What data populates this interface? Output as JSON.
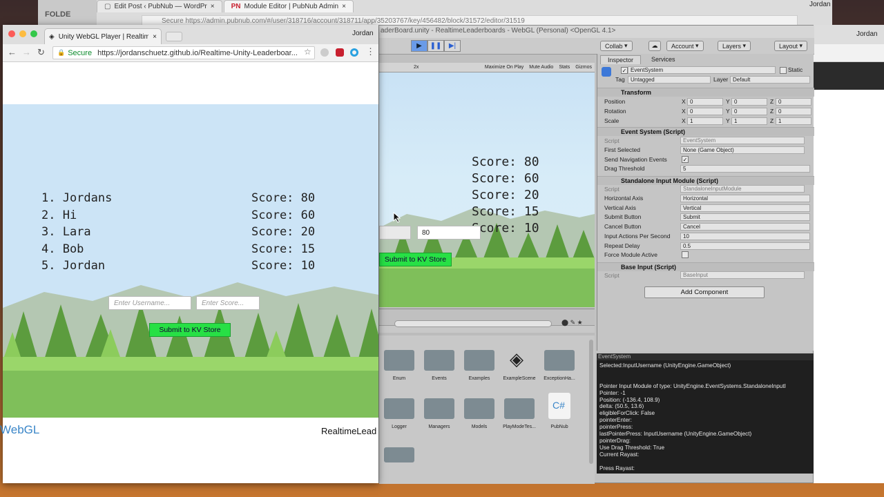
{
  "back_browser": {
    "tabs": [
      {
        "label": "Edit Post ‹ PubNub — WordPr"
      },
      {
        "label": "Module Editor | PubNub Admin"
      }
    ],
    "folder_label": "FOLDE",
    "url": "Secure  https://admin.pubnub.com/#/user/318716/account/318711/app/35203767/key/456482/block/31572/editor/31519",
    "user": "Jordan"
  },
  "right_window": {
    "user": "Jordan"
  },
  "unity": {
    "title": "aderBoard.unity - RealtimeLeaderboards - WebGL (Personal) <OpenGL 4.1>",
    "toolbar": {
      "collab": "Collab",
      "account": "Account",
      "layers": "Layers",
      "layout": "Layout"
    },
    "game_toolbar": {
      "scale": "2x",
      "options": [
        "Maximize On Play",
        "Mute Audio",
        "Stats",
        "Gizmos"
      ]
    },
    "game_view": {
      "scores": [
        "Score: 80",
        "Score: 60",
        "Score: 20",
        "Score: 15",
        "Score: 10"
      ],
      "score_input": "80",
      "submit_label": "Submit to KV Store"
    },
    "project": {
      "folders": [
        "Enum",
        "Events",
        "Examples",
        "ExampleScene",
        "ExceptionHa...",
        "Logger",
        "Managers",
        "Models",
        "PlayModeTes...",
        "PubNub"
      ]
    },
    "inspector": {
      "tabs": [
        "Inspector",
        "Services"
      ],
      "object_name": "EventSystem",
      "static_label": "Static",
      "tag_label": "Tag",
      "tag_value": "Untagged",
      "layer_label": "Layer",
      "layer_value": "Default",
      "transform": {
        "header": "Transform",
        "rows": [
          {
            "label": "Position",
            "x": "0",
            "y": "0",
            "z": "0"
          },
          {
            "label": "Rotation",
            "x": "0",
            "y": "0",
            "z": "0"
          },
          {
            "label": "Scale",
            "x": "1",
            "y": "1",
            "z": "1"
          }
        ]
      },
      "event_system": {
        "header": "Event System (Script)",
        "script_label": "Script",
        "script_value": "EventSystem",
        "first_selected_label": "First Selected",
        "first_selected_value": "None (Game Object)",
        "send_nav_label": "Send Navigation Events",
        "drag_label": "Drag Threshold",
        "drag_value": "5"
      },
      "standalone": {
        "header": "Standalone Input Module (Script)",
        "script_label": "Script",
        "script_value": "StandaloneInputModule",
        "rows": [
          {
            "label": "Horizontal Axis",
            "value": "Horizontal"
          },
          {
            "label": "Vertical Axis",
            "value": "Vertical"
          },
          {
            "label": "Submit Button",
            "value": "Submit"
          },
          {
            "label": "Cancel Button",
            "value": "Cancel"
          },
          {
            "label": "Input Actions Per Second",
            "value": "10"
          },
          {
            "label": "Repeat Delay",
            "value": "0.5"
          }
        ],
        "force_label": "Force Module Active"
      },
      "base_input": {
        "header": "Base Input (Script)",
        "script_label": "Script",
        "script_value": "BaseInput"
      },
      "add_component": "Add Component"
    },
    "console": {
      "title": "EventSystem",
      "text": "Selected:InputUsername (UnityEngine.GameObject)\n\n\nPointer Input Module of type: UnityEngine.EventSystems.StandaloneInputI\nPointer: -1\nPosition: (-136.4, 108.9)\ndelta: (50.5, 13.6)\neligibleForClick: False\npointerEnter:\npointerPress:\nlastPointerPress: InputUsername (UnityEngine.GameObject)\npointerDrag:\nUse Drag Threshold: True\nCurrent Rayast:\n\nPress Rayast:"
    }
  },
  "front_browser": {
    "tab_label": "Unity WebGL Player | Realtime",
    "user": "Jordan",
    "secure_label": "Secure",
    "url": "https://jordanschuetz.github.io/Realtime-Unity-Leaderboar...",
    "leaderboard": {
      "names": [
        "1. Jordans",
        "2. Hi",
        "3. Lara",
        "4. Bob",
        "5. Jordan"
      ],
      "scores": [
        "Score: 80",
        "Score: 60",
        "Score: 20",
        "Score: 15",
        "Score: 10"
      ]
    },
    "username_placeholder": "Enter Username...",
    "score_placeholder": "Enter Score...",
    "submit_label": "Submit to KV Store",
    "webgl_logo": "WebGL",
    "footer_title": "RealtimeLead"
  },
  "colors": {
    "submit_green": "#27e045",
    "sky": "#cce4f6",
    "grass": "#7fbf5a"
  }
}
